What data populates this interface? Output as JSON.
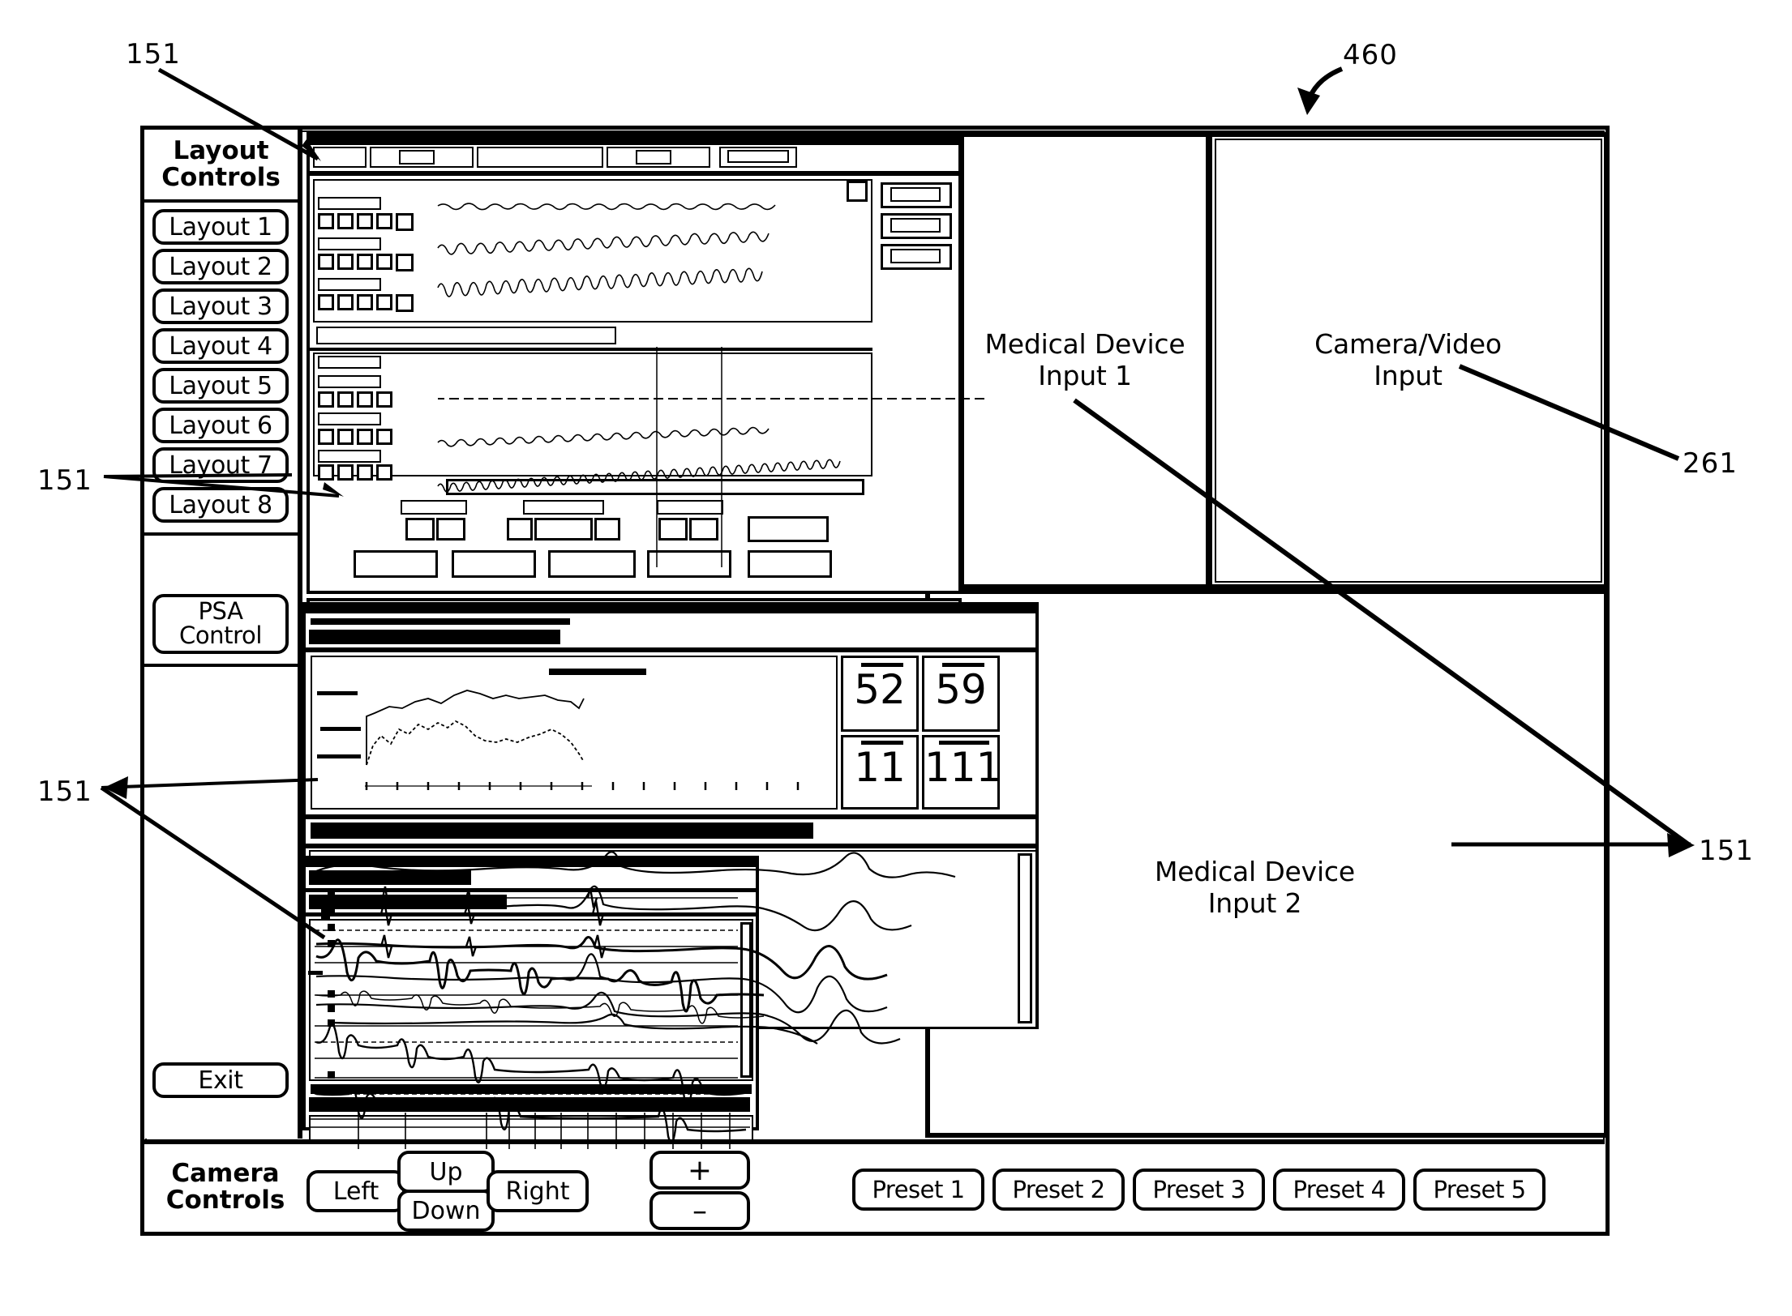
{
  "figure": {
    "number": "460",
    "callouts": [
      {
        "id": "ref-460",
        "text": "460"
      },
      {
        "id": "ref-261",
        "text": "261"
      },
      {
        "id": "ref-151-a",
        "text": "151"
      },
      {
        "id": "ref-151-b",
        "text": "151"
      },
      {
        "id": "ref-151-c",
        "text": "151"
      },
      {
        "id": "ref-151-d",
        "text": "151"
      }
    ]
  },
  "sidebar": {
    "title_line1": "Layout",
    "title_line2": "Controls",
    "layout_buttons": [
      {
        "label": "Layout 1"
      },
      {
        "label": "Layout 2"
      },
      {
        "label": "Layout 3"
      },
      {
        "label": "Layout 4"
      },
      {
        "label": "Layout 5"
      },
      {
        "label": "Layout 6"
      },
      {
        "label": "Layout 7"
      },
      {
        "label": "Layout 8"
      }
    ],
    "psa_control_line1": "PSA",
    "psa_control_line2": "Control",
    "exit_label": "Exit"
  },
  "camera_controls": {
    "title_line1": "Camera",
    "title_line2": "Controls",
    "pan": {
      "left": "Left",
      "up": "Up",
      "down": "Down",
      "right": "Right"
    },
    "zoom": {
      "in": "+",
      "out": "–"
    },
    "presets": [
      {
        "label": "Preset 1"
      },
      {
        "label": "Preset 2"
      },
      {
        "label": "Preset 3"
      },
      {
        "label": "Preset 4"
      },
      {
        "label": "Preset 5"
      }
    ]
  },
  "panes": {
    "medical_device_1": "Medical Device\nInput 1",
    "camera_video": "Camera/Video\nInput",
    "medical_device_2": "Medical Device\nInput 2"
  },
  "vitals_window": {
    "readouts": [
      {
        "value": "52"
      },
      {
        "value": "59"
      },
      {
        "value": "11"
      },
      {
        "value": "111"
      }
    ]
  }
}
